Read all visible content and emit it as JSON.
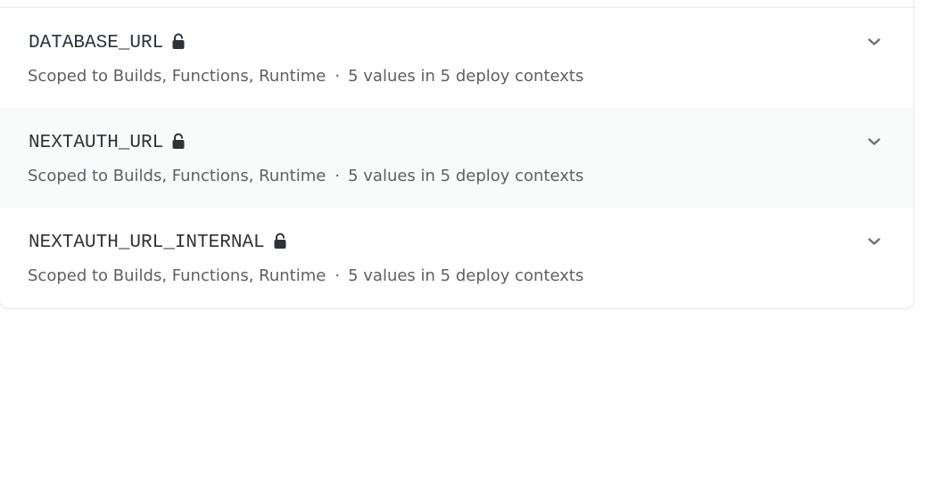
{
  "variables": [
    {
      "name": "DATABASE_URL",
      "scope": "Scoped to Builds, Functions, Runtime",
      "separator": "·",
      "values_summary": "5 values in 5 deploy contexts",
      "lock_icon": "lock-open-icon",
      "expand_icon": "chevron-down-icon"
    },
    {
      "name": "NEXTAUTH_URL",
      "scope": "Scoped to Builds, Functions, Runtime",
      "separator": "·",
      "values_summary": "5 values in 5 deploy contexts",
      "lock_icon": "lock-open-icon",
      "expand_icon": "chevron-down-icon"
    },
    {
      "name": "NEXTAUTH_URL_INTERNAL",
      "scope": "Scoped to Builds, Functions, Runtime",
      "separator": "·",
      "values_summary": "5 values in 5 deploy contexts",
      "lock_icon": "lock-open-icon",
      "expand_icon": "chevron-down-icon"
    }
  ],
  "colors": {
    "text_primary": "#2d3338",
    "text_secondary": "#5b6166",
    "row_alt_bg": "#f9fafa",
    "border": "#e6e8ea"
  }
}
